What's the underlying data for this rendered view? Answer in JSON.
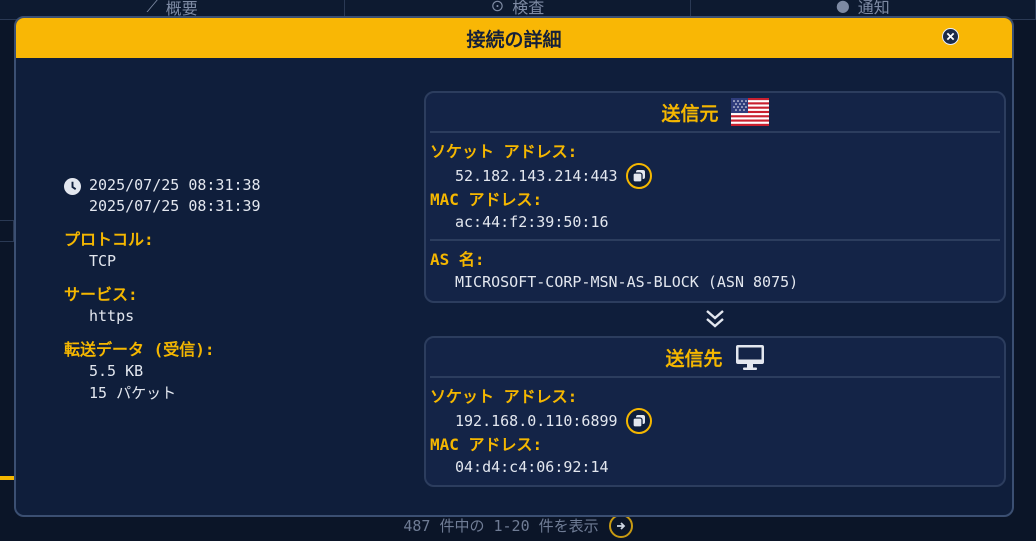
{
  "background": {
    "tabs": [
      {
        "label": "概要",
        "icon": "chart-icon"
      },
      {
        "label": "検査",
        "icon": "search-icon"
      },
      {
        "label": "通知",
        "icon": "bell-icon"
      }
    ],
    "footer_text": "487 件中の 1-20 件を表示"
  },
  "modal": {
    "title": "接続の詳細",
    "accent": "#f9b705"
  },
  "summary": {
    "time_start": "2025/07/25 08:31:38",
    "time_end": "2025/07/25 08:31:39",
    "protocol_label": "プロトコル:",
    "protocol_value": "TCP",
    "service_label": "サービス:",
    "service_value": "https",
    "transfer_label": "転送データ (受信):",
    "transfer_bytes": "5.5 KB",
    "transfer_packets": "15 パケット"
  },
  "source": {
    "title": "送信元",
    "flag_icon": "us-flag-icon",
    "socket_label": "ソケット アドレス:",
    "socket_value": "52.182.143.214:443",
    "mac_label": "MAC アドレス:",
    "mac_value": "ac:44:f2:39:50:16",
    "as_label": "AS 名:",
    "as_value": "MICROSOFT-CORP-MSN-AS-BLOCK (ASN 8075)"
  },
  "destination": {
    "title": "送信先",
    "device_icon": "monitor-icon",
    "socket_label": "ソケット アドレス:",
    "socket_value": "192.168.0.110:6899",
    "mac_label": "MAC アドレス:",
    "mac_value": "04:d4:c4:06:92:14"
  }
}
